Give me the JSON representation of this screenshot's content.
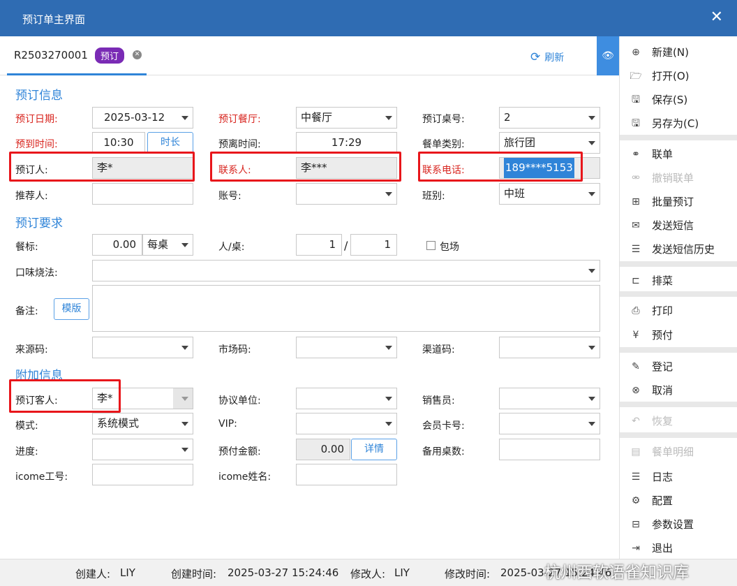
{
  "window": {
    "title": "预订单主界面",
    "close": "✕"
  },
  "tab": {
    "id": "R2503270001",
    "badge": "预订",
    "refresh_label": "刷新"
  },
  "sections": {
    "booking_info": "预订信息",
    "booking_requirements": "预订要求",
    "additional_info": "附加信息"
  },
  "labels": {
    "booking_date": "预订日期:",
    "booking_restaurant": "预订餐厅:",
    "booking_table_no": "预订桌号:",
    "arrival_time": "预到时间:",
    "departure_time": "预离时间:",
    "menu_type": "餐单类别:",
    "booker": "预订人:",
    "contact": "联系人:",
    "contact_phone": "联系电话:",
    "referrer": "推荐人:",
    "account": "账号:",
    "shift": "班别:",
    "meal_standard": "餐标:",
    "people_per_table": "人/桌:",
    "private_room": "包场",
    "taste": "口味烧法:",
    "remark": "备注:",
    "source_code": "来源码:",
    "market_code": "市场码:",
    "channel_code": "渠道码:",
    "booking_guest": "预订客人:",
    "agreement_unit": "协议单位:",
    "salesperson": "销售员:",
    "mode": "模式:",
    "vip": "VIP:",
    "member_card": "会员卡号:",
    "progress": "进度:",
    "prepaid_amount": "预付金额:",
    "spare_tables": "备用桌数:",
    "icome_id": "icome工号:",
    "icome_name": "icome姓名:"
  },
  "values": {
    "booking_date": "2025-03-12",
    "booking_restaurant": "中餐厅",
    "booking_table_no": "2",
    "arrival_time": "10:30",
    "duration_button": "时长",
    "departure_time": "17:29",
    "menu_type": "旅行团",
    "booker": "李*",
    "contact": "李***",
    "contact_phone": "189****5153",
    "shift": "中班",
    "meal_standard": "0.00",
    "meal_unit": "每桌",
    "people": "1",
    "people_sep": "/",
    "tables": "1",
    "template_button": "模版",
    "booking_guest": "李*",
    "mode": "系统模式",
    "prepaid_amount": "0.00",
    "detail_button": "详情"
  },
  "sidebar": {
    "items": [
      {
        "label": "新建(N)",
        "icon": "plus-circle-icon",
        "glyph": "⊕",
        "disabled": false
      },
      {
        "label": "打开(O)",
        "icon": "folder-open-icon",
        "glyph": "🗁",
        "disabled": false
      },
      {
        "label": "保存(S)",
        "icon": "save-icon",
        "glyph": "🖫",
        "disabled": false
      },
      {
        "label": "另存为(C)",
        "icon": "save-as-icon",
        "glyph": "🖫",
        "disabled": false
      },
      {
        "label": "联单",
        "icon": "link-icon",
        "glyph": "⚭",
        "disabled": false
      },
      {
        "label": "撤销联单",
        "icon": "unlink-icon",
        "glyph": "⚮",
        "disabled": true
      },
      {
        "label": "批量预订",
        "icon": "batch-booking-icon",
        "glyph": "⊞",
        "disabled": false
      },
      {
        "label": "发送短信",
        "icon": "mail-icon",
        "glyph": "✉",
        "disabled": false
      },
      {
        "label": "发送短信历史",
        "icon": "sms-history-icon",
        "glyph": "☰",
        "disabled": false
      },
      {
        "label": "排菜",
        "icon": "arrange-dishes-icon",
        "glyph": "⊏",
        "disabled": false
      },
      {
        "label": "打印",
        "icon": "print-icon",
        "glyph": "⎙",
        "disabled": false
      },
      {
        "label": "预付",
        "icon": "prepay-icon",
        "glyph": "¥",
        "disabled": false
      },
      {
        "label": "登记",
        "icon": "register-icon",
        "glyph": "✎",
        "disabled": false
      },
      {
        "label": "取消",
        "icon": "cancel-icon",
        "glyph": "⊗",
        "disabled": false
      },
      {
        "label": "恢复",
        "icon": "restore-icon",
        "glyph": "↶",
        "disabled": true
      },
      {
        "label": "餐单明细",
        "icon": "menu-detail-icon",
        "glyph": "▤",
        "disabled": true
      },
      {
        "label": "日志",
        "icon": "log-icon",
        "glyph": "☰",
        "disabled": false
      },
      {
        "label": "配置",
        "icon": "settings-icon",
        "glyph": "⚙",
        "disabled": false
      },
      {
        "label": "参数设置",
        "icon": "parameters-icon",
        "glyph": "⊟",
        "disabled": false
      },
      {
        "label": "退出",
        "icon": "exit-icon",
        "glyph": "⇥",
        "disabled": false
      }
    ]
  },
  "footer": {
    "creator_label": "创建人:",
    "creator": "LIY",
    "created_label": "创建时间:",
    "created": "2025-03-27 15:24:46",
    "modifier_label": "修改人:",
    "modifier": "LIY",
    "modified_label": "修改时间:",
    "modified": "2025-03-27 15:24:46",
    "watermark": "杭州西软语雀知识库"
  },
  "colors": {
    "titlebar": "#2f6cb3",
    "accent": "#2f84d8",
    "highlight": "#e8161b",
    "required_label": "#d8251f",
    "badge": "#7a2bb5"
  }
}
